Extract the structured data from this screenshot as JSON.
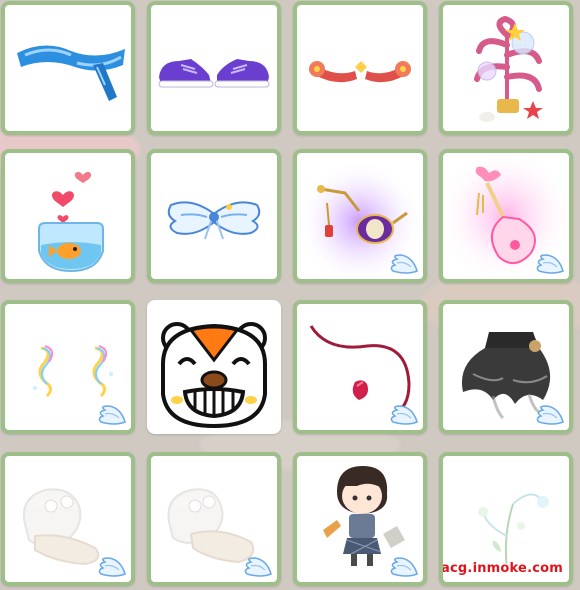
{
  "watermark": "acg.inmoke.com",
  "colors": {
    "card_border": "#9fbf8a",
    "card_bg": "#ffffff",
    "watermark": "#e0141b"
  },
  "items": [
    {
      "name": "blue-scarf",
      "wing_badge": false
    },
    {
      "name": "purple-sneakers",
      "wing_badge": false
    },
    {
      "name": "red-ribbon-bands",
      "wing_badge": false
    },
    {
      "name": "coral-tree-globe",
      "wing_badge": false
    },
    {
      "name": "goldfish-bowl-hearts",
      "wing_badge": false
    },
    {
      "name": "blue-angel-wings-bow",
      "wing_badge": false
    },
    {
      "name": "purple-drum-ornament",
      "wing_badge": true
    },
    {
      "name": "pink-pipa-lute",
      "wing_badge": true
    },
    {
      "name": "rainbow-swirl-sparkles",
      "wing_badge": true
    },
    {
      "name": "grinning-hamster-face",
      "wing_badge": false
    },
    {
      "name": "devil-tail",
      "wing_badge": true
    },
    {
      "name": "black-gothic-skirt",
      "wing_badge": true
    },
    {
      "name": "faded-white-shoes-left",
      "wing_badge": true
    },
    {
      "name": "faded-white-shoes",
      "wing_badge": true
    },
    {
      "name": "chibi-boy-avatar",
      "wing_badge": true
    },
    {
      "name": "faded-green-spray",
      "wing_badge": true
    }
  ]
}
